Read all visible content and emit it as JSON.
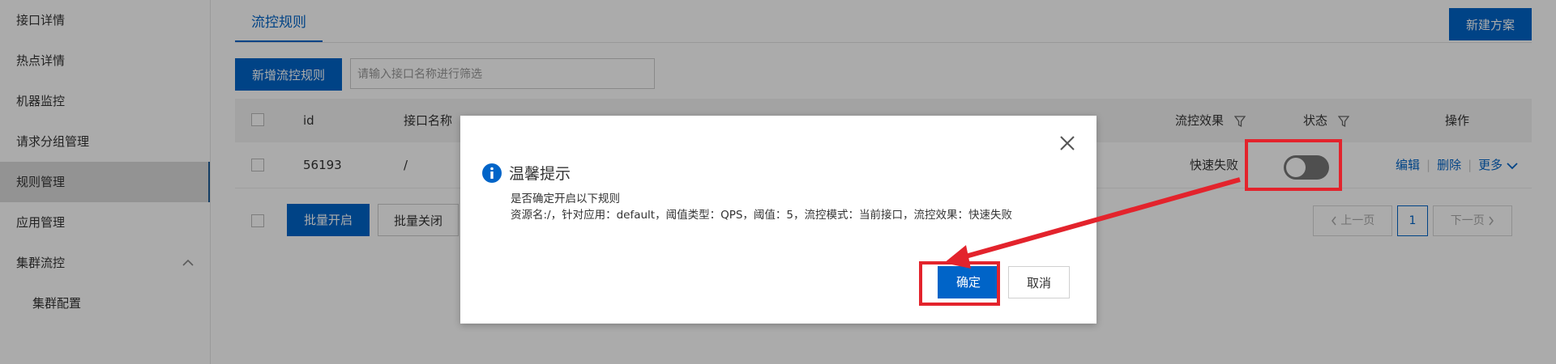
{
  "sidebar": {
    "items": [
      {
        "label": "接口详情"
      },
      {
        "label": "热点详情"
      },
      {
        "label": "机器监控"
      },
      {
        "label": "请求分组管理"
      },
      {
        "label": "规则管理"
      },
      {
        "label": "应用管理"
      },
      {
        "label": "集群流控"
      },
      {
        "label": "集群配置"
      }
    ],
    "active_index": 4
  },
  "tabs": {
    "active": "流控规则"
  },
  "toolbar": {
    "new_plan": "新建方案",
    "add_rule": "新增流控规则",
    "search_placeholder": "请输入接口名称进行筛选"
  },
  "table": {
    "headers": {
      "id": "id",
      "name": "接口名称",
      "effect": "流控效果",
      "status": "状态",
      "ops": "操作"
    },
    "row": {
      "id": "56193",
      "name": "/",
      "effect": "快速失败",
      "status_on": false,
      "edit": "编辑",
      "delete": "删除",
      "more": "更多"
    }
  },
  "footer": {
    "batch_enable": "批量开启",
    "batch_disable": "批量关闭",
    "prev": "上一页",
    "page": "1",
    "next": "下一页"
  },
  "dialog": {
    "title": "温馨提示",
    "line1": "是否确定开启以下规则",
    "line2": "资源名:/，针对应用：default，阈值类型：QPS，阈值：5，流控模式：当前接口，流控效果：快速失败",
    "ok": "确定",
    "cancel": "取消"
  },
  "colors": {
    "primary": "#0064c8",
    "annotation": "#e3232c",
    "overlay": "rgba(0,0,0,0.33)"
  }
}
